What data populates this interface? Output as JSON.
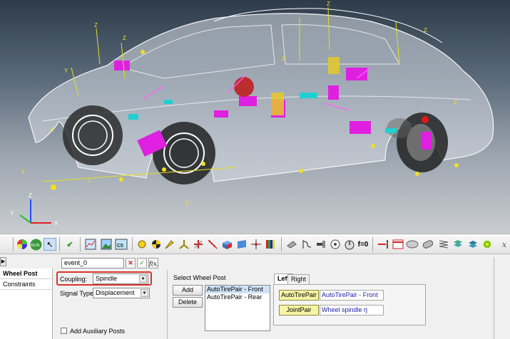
{
  "viewport": {
    "axis_labels": {
      "x": "X",
      "y": "Y",
      "z": "Z"
    }
  },
  "toolbar": {
    "icons": [
      "color-wheel-icon",
      "run-icon",
      "pointer-icon",
      "check-icon",
      "plot-icon",
      "image-icon",
      "cs-icon",
      "point-icon",
      "body-icon",
      "marker-icon",
      "graphic-icon",
      "joint-icon",
      "spring-icon",
      "box-icon",
      "surface-icon",
      "field-icon",
      "bushing-icon",
      "beam-icon",
      "gear-icon",
      "motion-icon",
      "force-icon",
      "output-icon",
      "fx-icon"
    ],
    "run_label": "RUN",
    "cs_label": "cs",
    "fx0_label": "f=0"
  },
  "panel": {
    "event_value": "event_0",
    "nav": [
      {
        "label": "Wheel Post",
        "active": true
      },
      {
        "label": "Constraints",
        "active": false
      }
    ],
    "coupling_label": "Coupling:",
    "coupling_value": "Spindle",
    "signal_type_label": "Signal Type:",
    "signal_type_value": "Displacement",
    "add_auxiliary_label": "Add Auxiliary Posts",
    "select_wheel_post_label": "Select Wheel Post",
    "add_button": "Add",
    "delete_button": "Delete",
    "wheel_posts": [
      "AutoTirePair - Front",
      "AutoTirePair - Rear"
    ],
    "tabs": [
      {
        "label": "Left",
        "active": true
      },
      {
        "label": "Right",
        "active": false
      }
    ],
    "autotirepair_button": "AutoTirePair",
    "autotirepair_value": "AutoTirePair - Front",
    "jointpair_button": "JointPair",
    "jointpair_value": "Wheel spindle rj"
  },
  "colors": {
    "highlight": "#d9342b",
    "magenta": "#e020e0",
    "yellow_button": "#f6f5a5"
  }
}
